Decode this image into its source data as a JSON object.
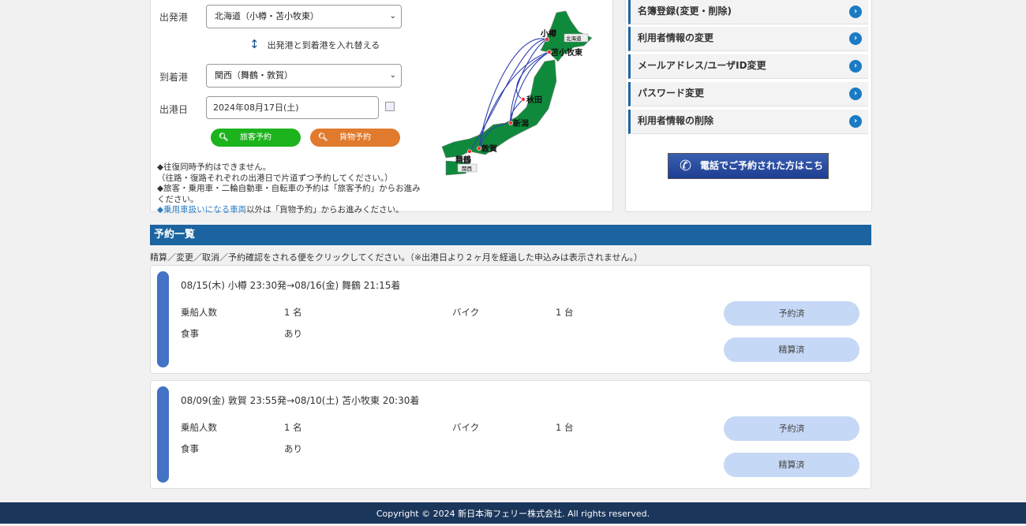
{
  "search": {
    "departure_label": "出発港",
    "departure_value": "北海道（小樽・苫小牧東）",
    "swap_label": "出発港と到着港を入れ替える",
    "arrival_label": "到着港",
    "arrival_value": "関西（舞鶴・敦賀）",
    "date_label": "出港日",
    "date_value": "2024年08月17日(土)",
    "passenger_button": "旅客予約",
    "cargo_button": "貨物予約",
    "notes": [
      "◆往復同時予約はできません。",
      "（往路・復路それぞれの出港日で片道ずつ予約してください。）",
      "◆旅客・乗用車・二輪自動車・自転車の予約は「旅客予約」からお進みください。"
    ],
    "note_link": "◆乗用車扱いになる車両",
    "note_link_suffix": "以外は「貨物予約」からお進みください。"
  },
  "map": {
    "ports": [
      "小樽",
      "苫小牧東",
      "秋田",
      "新潟",
      "敦賀",
      "舞鶴"
    ],
    "region_tags": [
      "北海道",
      "関西"
    ],
    "land_color": "#0f8a3c",
    "route_color": "#3040b0"
  },
  "menu": {
    "items": [
      "名簿登録(変更・削除)",
      "利用者情報の変更",
      "メールアドレス/ユーザID変更",
      "パスワード変更",
      "利用者情報の削除"
    ],
    "phone_button": "電話でご予約された方はこちら"
  },
  "reservations": {
    "title": "予約一覧",
    "instruction": "精算／変更／取消／予約確認をされる便をクリックしてください。（※出港日より２ヶ月を経過した申込みは表示されません。）",
    "items": [
      {
        "route": "08/15(木) 小樽 23:30発→08/16(金) 舞鶴 21:15着",
        "passengers_label": "乗船人数",
        "passengers": "1 名",
        "bike_label": "バイク",
        "bike": "1 台",
        "meal_label": "食事",
        "meal": "あり",
        "status1": "予約済",
        "status2": "精算済"
      },
      {
        "route": "08/09(金) 敦賀 23:55発→08/10(土) 苫小牧東 20:30着",
        "passengers_label": "乗船人数",
        "passengers": "1 名",
        "bike_label": "バイク",
        "bike": "1 台",
        "meal_label": "食事",
        "meal": "あり",
        "status1": "予約済",
        "status2": "精算済"
      }
    ]
  },
  "footer": {
    "copyright": "Copyright © 2024 新日本海フェリー株式会社. All rights reserved."
  }
}
